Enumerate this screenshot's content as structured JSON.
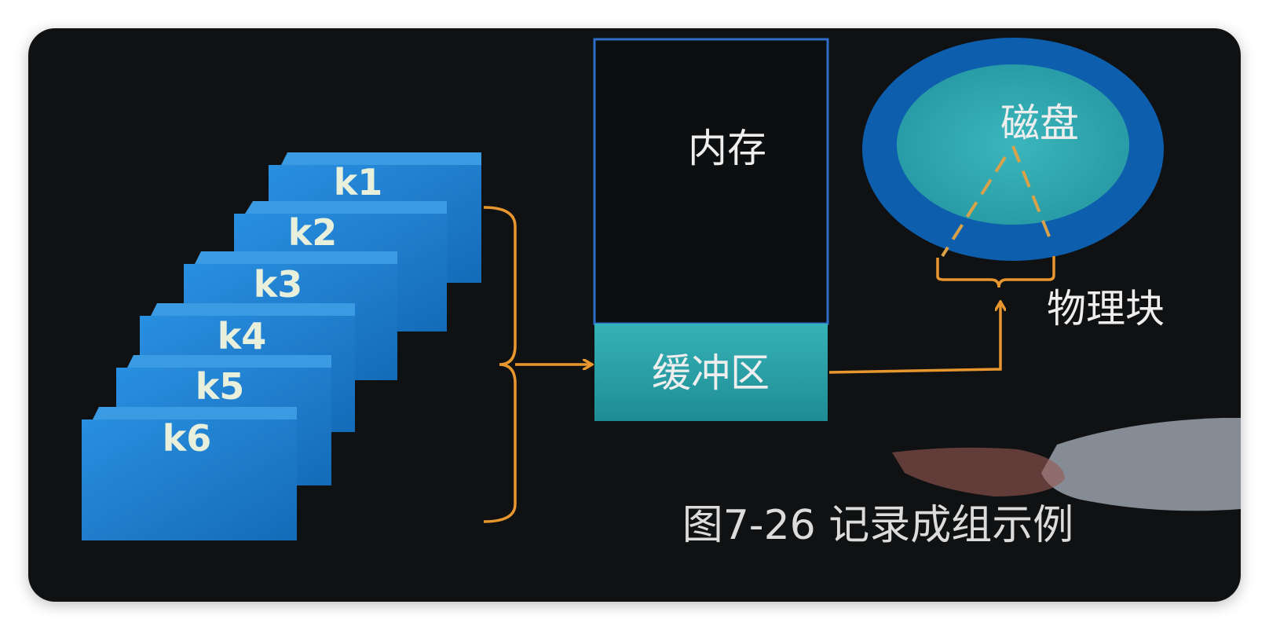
{
  "blocks": [
    "k1",
    "k2",
    "k3",
    "k4",
    "k5",
    "k6"
  ],
  "memory": {
    "label": "内存",
    "buffer_label": "缓冲区"
  },
  "disk": {
    "label": "磁盘",
    "physical_block_label": "物理块"
  },
  "caption": "图7-26 记录成组示例",
  "colors": {
    "background": "#0f1112",
    "block_fill": "#1f7fd0",
    "block_top": "#3b9be2",
    "block_side": "#0b4f8e",
    "memory_border": "#2d6fc8",
    "buffer_fill": "#2aa0a6",
    "disk_outer": "#0d5fae",
    "disk_inner": "#2fa8b0",
    "arrow": "#e8962e"
  }
}
